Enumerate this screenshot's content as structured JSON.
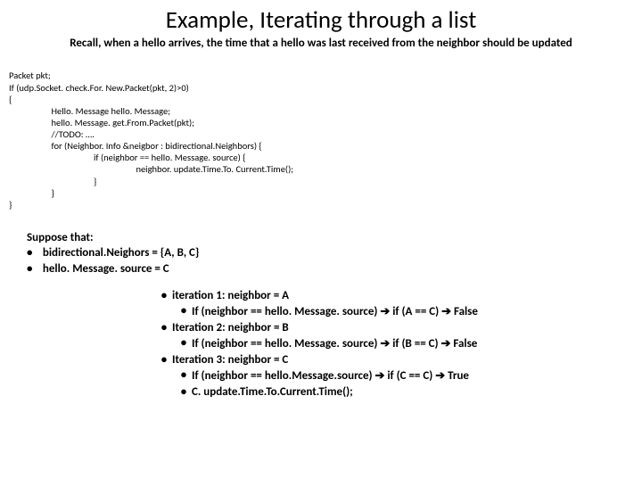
{
  "title": "Example, Iterating through a list",
  "subtitle": "Recall, when a hello arrives, the time that a hello was last received from the neighbor should be updated",
  "code": {
    "l1": "Packet pkt;",
    "l2": "If (udp.Socket. check.For. New.Packet(pkt, 2)>0)",
    "l3": "{",
    "l4": "Hello. Message hello. Message;",
    "l5": "hello. Message. get.From.Packet(pkt);",
    "l6": "//TODO: ….",
    "l7": "for (Neighbor. Info &neigbor : bidirectional.Neighbors) {",
    "l8": "if (neighbor == hello. Message. source) {",
    "l9": "neighbor. update.Time.To. Current.Time();",
    "l10": "}",
    "l11": "}",
    "l12": "}"
  },
  "suppose": {
    "heading": "Suppose that:",
    "b1": "bidirectional.Neighors = {A, B, C}",
    "b2": "hello. Message. source = C"
  },
  "iters": {
    "i1": "iteration 1:  neighbor = A",
    "i1a_pre": "If (neighbor == hello. Message. source) ",
    "i1a_mid": " if (A == C) ",
    "i1a_end": " False",
    "i2": "Iteration 2: neighbor = B",
    "i2a_pre": "If (neighbor == hello. Message. source) ",
    "i2a_mid": " if (B == C) ",
    "i2a_end": " False",
    "i3": "Iteration 3: neighbor = C",
    "i3a_pre": "If (neighbor == hello.Message.source) ",
    "i3a_mid": " if (C == C) ",
    "i3a_end": " True",
    "i3b": "C. update.Time.To.Current.Time();"
  },
  "glyphs": {
    "bullet": "•",
    "arrow": "➔"
  }
}
